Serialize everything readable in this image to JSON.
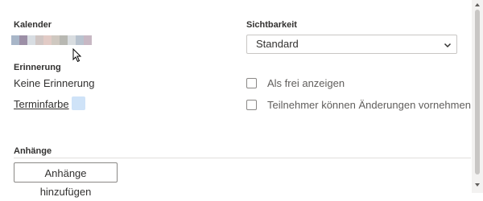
{
  "calendar": {
    "label": "Kalender",
    "blurred_colors": [
      "#a8b6c8",
      "#9c8fa6",
      "#d8dde2",
      "#d0c6c4",
      "#e2cbc6",
      "#cfc8c0",
      "#b8b8b2",
      "#d9dde0",
      "#b9c3cf",
      "#c8b8c4"
    ]
  },
  "visibility": {
    "label": "Sichtbarkeit",
    "selected": "Standard"
  },
  "reminder": {
    "label": "Erinnerung",
    "value": "Keine Erinnerung"
  },
  "event_color": {
    "label": "Terminfarbe",
    "color": "#cfe3f8"
  },
  "options": {
    "show_as_free": "Als frei anzeigen",
    "attendees_can_modify": "Teilnehmer können Änderungen vornehmen"
  },
  "attachments": {
    "label": "Anhänge",
    "add_button": "Anhänge hinzufügen"
  }
}
